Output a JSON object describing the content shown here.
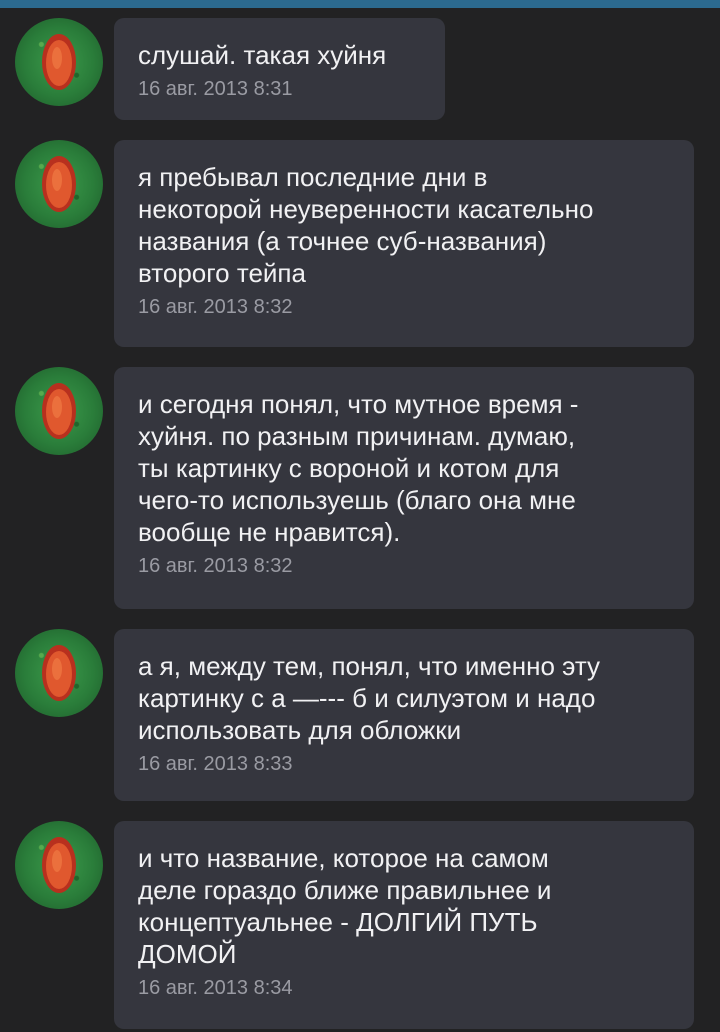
{
  "messages": [
    {
      "text": "слушай. такая хуйня",
      "time": "16 авг. 2013 8:31"
    },
    {
      "text": "я пребывал последние дни в\nнекоторой неуверенности касательно\nназвания (а точнее суб-названия)\nвторого тейпа",
      "time": "16 авг. 2013 8:32"
    },
    {
      "text": "и сегодня понял, что мутное время -\nхуйня. по разным причинам. думаю,\nты картинку с вороной и котом для\nчего-то используешь (благо она мне\nвообще не нравится).",
      "time": "16 авг. 2013 8:32"
    },
    {
      "text": "а я, между тем, понял, что именно эту\nкартинку с а —--- б и силуэтом и надо\nиспользовать для обложки",
      "time": "16 авг. 2013 8:33"
    },
    {
      "text": "и что название, которое на самом\nделе гораздо ближе правильнее и\nконцептуальнее - ДОЛГИЙ ПУТЬ\nДОМОЙ",
      "time": "16 авг. 2013 8:34"
    }
  ]
}
